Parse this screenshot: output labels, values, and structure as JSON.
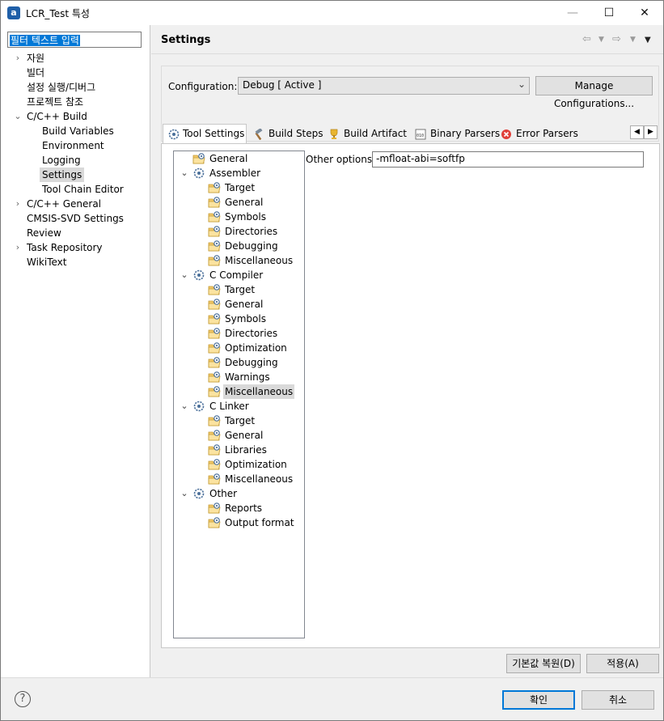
{
  "window": {
    "title": "LCR_Test 특성",
    "app_icon_letter": "a"
  },
  "filter": {
    "value": "필터 텍스트 입력"
  },
  "nav": {
    "items": [
      {
        "label": "자원",
        "arrow": "›"
      },
      {
        "label": "빌더",
        "arrow": ""
      },
      {
        "label": "설정 실행/디버그",
        "arrow": ""
      },
      {
        "label": "프로젝트 참조",
        "arrow": ""
      },
      {
        "label": "C/C++ Build",
        "arrow": "⌄"
      },
      {
        "label": "Build Variables",
        "arrow": ""
      },
      {
        "label": "Environment",
        "arrow": ""
      },
      {
        "label": "Logging",
        "arrow": ""
      },
      {
        "label": "Settings",
        "arrow": ""
      },
      {
        "label": "Tool Chain Editor",
        "arrow": ""
      },
      {
        "label": "C/C++ General",
        "arrow": "›"
      },
      {
        "label": "CMSIS-SVD Settings",
        "arrow": ""
      },
      {
        "label": "Review",
        "arrow": ""
      },
      {
        "label": "Task Repository",
        "arrow": "›"
      },
      {
        "label": "WikiText",
        "arrow": ""
      }
    ],
    "selected_index": 8
  },
  "settings": {
    "title": "Settings"
  },
  "config": {
    "label": "Configuration:",
    "value": "Debug  [ Active ]",
    "manage_label": "Manage Configurations..."
  },
  "tabs": [
    {
      "label": "Tool Settings",
      "icon": "gear-icon"
    },
    {
      "label": "Build Steps",
      "icon": "hammer-icon"
    },
    {
      "label": "Build Artifact",
      "icon": "trophy-icon"
    },
    {
      "label": "Binary Parsers",
      "icon": "binary-icon"
    },
    {
      "label": "Error Parsers",
      "icon": "error-icon"
    }
  ],
  "tree": {
    "nodes": [
      {
        "label": "General"
      },
      {
        "label": "Assembler",
        "expander": "⌄"
      },
      {
        "label": "Target"
      },
      {
        "label": "General"
      },
      {
        "label": "Symbols"
      },
      {
        "label": "Directories"
      },
      {
        "label": "Debugging"
      },
      {
        "label": "Miscellaneous"
      },
      {
        "label": "C Compiler",
        "expander": "⌄"
      },
      {
        "label": "Target"
      },
      {
        "label": "General"
      },
      {
        "label": "Symbols"
      },
      {
        "label": "Directories"
      },
      {
        "label": "Optimization"
      },
      {
        "label": "Debugging"
      },
      {
        "label": "Warnings"
      },
      {
        "label": "Miscellaneous"
      },
      {
        "label": "C Linker",
        "expander": "⌄"
      },
      {
        "label": "Target"
      },
      {
        "label": "General"
      },
      {
        "label": "Libraries"
      },
      {
        "label": "Optimization"
      },
      {
        "label": "Miscellaneous"
      },
      {
        "label": "Other",
        "expander": "⌄"
      },
      {
        "label": "Reports"
      },
      {
        "label": "Output format"
      }
    ]
  },
  "options": {
    "label": "Other options",
    "value": "-mfloat-abi=softfp"
  },
  "buttons": {
    "restore_defaults": "기본값 복원(D)",
    "apply": "적용(A)",
    "ok": "확인",
    "cancel": "취소"
  },
  "help": {
    "glyph": "?"
  },
  "colors": {
    "accent": "#0078d7",
    "selection": "#d9d9d9"
  }
}
